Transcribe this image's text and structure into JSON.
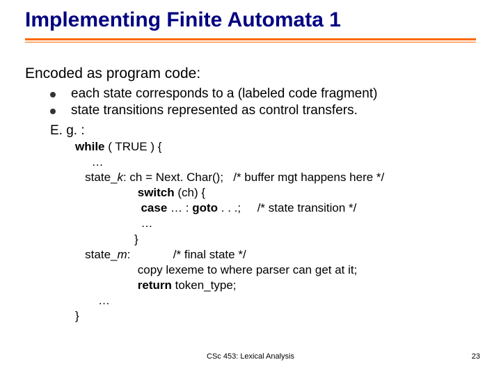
{
  "title": "Implementing Finite Automata 1",
  "subtitle": "Encoded as program code:",
  "bullets": [
    "each state corresponds to a (labeled code fragment)",
    "state transitions represented as control transfers."
  ],
  "eg_label": "E. g. :",
  "code": {
    "l0a": "while",
    "l0b": " ( TRUE ) {",
    "l1": "     …",
    "l2a": "   state_",
    "l2k": "k",
    "l2b": ": ch = Next. Char();   /* buffer mgt happens here */",
    "l3a": "                   ",
    "l3b": "switch",
    "l3c": " (ch) {",
    "l4a": "                    ",
    "l4b": "case",
    "l4c": " … : ",
    "l4d": "goto",
    "l4e": " . . .;     /* state transition */",
    "l5": "                    …",
    "l6": "                  }",
    "l7a": "   state_",
    "l7m": "m",
    "l7b": ":             /* final state */",
    "l8": "                   copy lexeme to where parser can get at it;",
    "l9a": "                   ",
    "l9b": "return",
    "l9c": " token_type;",
    "l10": "       …",
    "l11": "}"
  },
  "footer": {
    "center": "CSc 453: Lexical Analysis",
    "page": "23"
  }
}
